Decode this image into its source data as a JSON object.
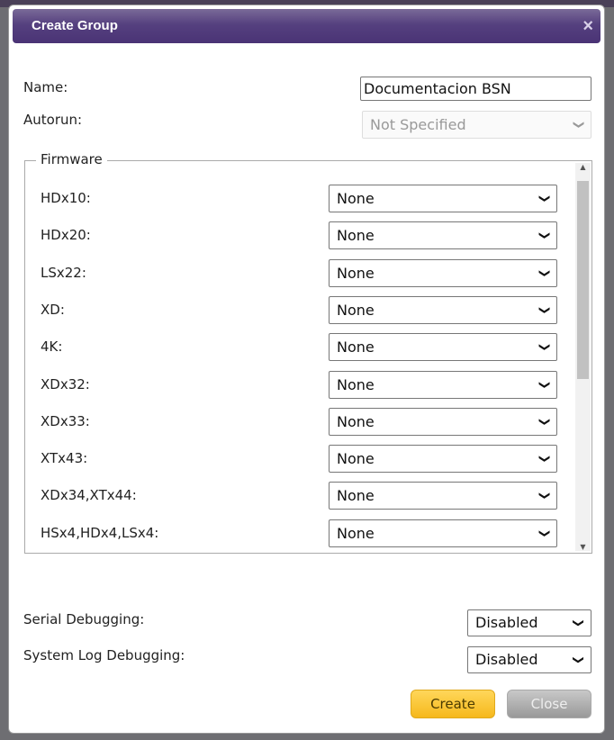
{
  "dialog": {
    "title": "Create Group",
    "close_icon": "×"
  },
  "name": {
    "label": "Name:",
    "value": "Documentacion BSN"
  },
  "autorun": {
    "label": "Autorun:",
    "value": "Not Specified"
  },
  "firmware": {
    "legend": "Firmware",
    "rows": [
      {
        "label": "HDx10:",
        "value": "None"
      },
      {
        "label": "HDx20:",
        "value": "None"
      },
      {
        "label": "LSx22:",
        "value": "None"
      },
      {
        "label": "XD:",
        "value": "None"
      },
      {
        "label": "4K:",
        "value": "None"
      },
      {
        "label": "XDx32:",
        "value": "None"
      },
      {
        "label": "XDx33:",
        "value": "None"
      },
      {
        "label": "XTx43:",
        "value": "None"
      },
      {
        "label": "XDx34,XTx44:",
        "value": "None"
      },
      {
        "label": "HSx4,HDx4,LSx4:",
        "value": "None"
      }
    ]
  },
  "serial": {
    "label": "Serial Debugging:",
    "value": "Disabled"
  },
  "syslog": {
    "label": "System Log Debugging:",
    "value": "Disabled"
  },
  "buttons": {
    "create": "Create",
    "close": "Close"
  }
}
